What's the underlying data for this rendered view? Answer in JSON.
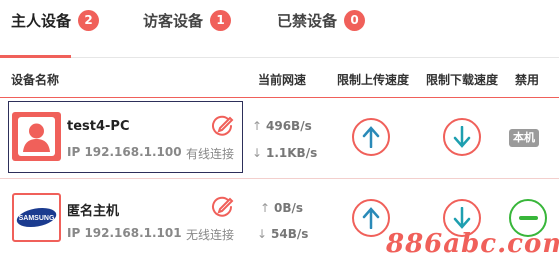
{
  "tabs": [
    {
      "label": "主人设备",
      "count": "2"
    },
    {
      "label": "访客设备",
      "count": "1"
    },
    {
      "label": "已禁设备",
      "count": "0"
    }
  ],
  "table": {
    "headers": {
      "name": "设备名称",
      "current_speed": "当前网速",
      "limit_up": "限制上传速度",
      "limit_down": "限制下载速度",
      "disable": "禁用"
    },
    "rows": [
      {
        "name": "test4-PC",
        "ip": "IP 192.168.1.100",
        "connection": "有线连接",
        "upload": "496B/s",
        "download": "1.1KB/s",
        "disable_label": "本机",
        "avatar": "user-avatar"
      },
      {
        "name": "匿名主机",
        "ip": "IP 192.168.1.101",
        "connection": "无线连接",
        "upload": "0B/s",
        "download": "54B/s",
        "disable_label": "",
        "avatar": "samsung-logo",
        "logo_text": "SAMSUNG"
      }
    ]
  },
  "watermark": "886abc.com",
  "colors": {
    "accent": "#f0605a",
    "upload_arrow": "#2a8ab8",
    "download_arrow": "#1e9fb0",
    "toggle": "#38b63a"
  }
}
